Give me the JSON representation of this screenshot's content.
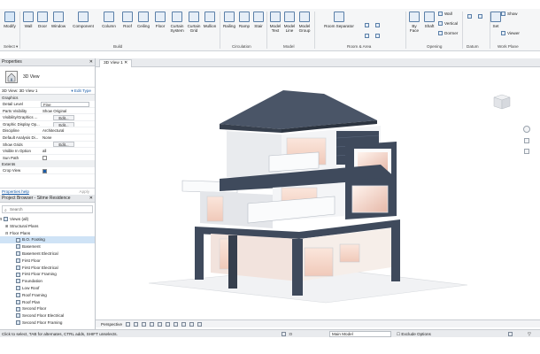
{
  "ribbon": {
    "buttons": [
      {
        "label": "Modify",
        "icon": "modify-arrow-icon"
      },
      {
        "label": "Wall",
        "icon": "wall-icon"
      },
      {
        "label": "Door",
        "icon": "door-icon"
      },
      {
        "label": "Window",
        "icon": "window-icon"
      },
      {
        "label": "Component",
        "icon": "component-icon"
      },
      {
        "label": "Column",
        "icon": "column-icon"
      },
      {
        "label": "Roof",
        "icon": "roof-icon"
      },
      {
        "label": "Ceiling",
        "icon": "ceiling-icon"
      },
      {
        "label": "Floor",
        "icon": "floor-icon"
      },
      {
        "label": "Curtain System",
        "icon": "curtain-system-icon"
      },
      {
        "label": "Curtain Grid",
        "icon": "curtain-grid-icon"
      },
      {
        "label": "Mullion",
        "icon": "mullion-icon"
      },
      {
        "label": "Railing",
        "icon": "railing-icon"
      },
      {
        "label": "Ramp",
        "icon": "ramp-icon"
      },
      {
        "label": "Stair",
        "icon": "stair-icon"
      },
      {
        "label": "Model Text",
        "icon": "model-text-icon"
      },
      {
        "label": "Model Line",
        "icon": "model-line-icon"
      },
      {
        "label": "Model Group",
        "icon": "model-group-icon"
      },
      {
        "label": "Room Separator",
        "icon": "room-separator-icon"
      },
      {
        "label": "By Face",
        "icon": "by-face-icon"
      },
      {
        "label": "Shaft",
        "icon": "shaft-icon"
      },
      {
        "label": "Set",
        "icon": "set-icon"
      }
    ],
    "small": {
      "wall": "Wall",
      "vertical": "Vertical",
      "dormer": "Dormer",
      "show": "Show",
      "viewer": "Viewer"
    },
    "groups": {
      "select": "Select",
      "build": "Build",
      "circulation": "Circulation",
      "model": "Model",
      "room_area": "Room & Area",
      "opening": "Opening",
      "datum": "Datum",
      "work_plane": "Work Plane"
    }
  },
  "properties": {
    "title": "Properties",
    "type_name": "3D View",
    "instance_label": "3D View: 3D View 1",
    "edit_type": "Edit Type",
    "category_graphics": "Graphics",
    "category_extents": "Extents",
    "rows": [
      {
        "k": "Detail Level",
        "v": "Fine",
        "kind": "box"
      },
      {
        "k": "Parts Visibility",
        "v": "Show Original",
        "kind": "text"
      },
      {
        "k": "Visibility/Graphics ...",
        "v": "Edit...",
        "kind": "btn"
      },
      {
        "k": "Graphic Display Op...",
        "v": "Edit...",
        "kind": "btn"
      },
      {
        "k": "Discipline",
        "v": "Architectural",
        "kind": "text"
      },
      {
        "k": "Default Analysis Di...",
        "v": "None",
        "kind": "text"
      },
      {
        "k": "Show Grids",
        "v": "Edit...",
        "kind": "btn"
      },
      {
        "k": "Visible In Option",
        "v": "all",
        "kind": "text"
      },
      {
        "k": "Sun Path",
        "v": "",
        "kind": "check"
      }
    ],
    "crop_view": "Crop View",
    "help": "Properties help",
    "apply": "Apply"
  },
  "browser": {
    "title": "Project Browser - Sitme Residence",
    "search_placeholder": "Search",
    "items": [
      {
        "label": "Views (all)",
        "indent": 0,
        "tog": "⊟",
        "icon": true,
        "hl": false
      },
      {
        "label": "Structural Plans",
        "indent": 1,
        "tog": "⊞",
        "icon": false,
        "hl": false
      },
      {
        "label": "Floor Plans",
        "indent": 1,
        "tog": "⊟",
        "icon": false,
        "hl": false
      },
      {
        "label": "B.O. Footing",
        "indent": 2,
        "tog": "",
        "icon": true,
        "hl": true
      },
      {
        "label": "Basement",
        "indent": 2,
        "tog": "",
        "icon": true,
        "hl": false
      },
      {
        "label": "Basement Electrical",
        "indent": 2,
        "tog": "",
        "icon": true,
        "hl": false
      },
      {
        "label": "First Floor",
        "indent": 2,
        "tog": "",
        "icon": true,
        "hl": false
      },
      {
        "label": "First Floor Electrical",
        "indent": 2,
        "tog": "",
        "icon": true,
        "hl": false
      },
      {
        "label": "First Floor Framing",
        "indent": 2,
        "tog": "",
        "icon": true,
        "hl": false
      },
      {
        "label": "Foundation",
        "indent": 2,
        "tog": "",
        "icon": true,
        "hl": false
      },
      {
        "label": "Low Roof",
        "indent": 2,
        "tog": "",
        "icon": true,
        "hl": false
      },
      {
        "label": "Roof Framing",
        "indent": 2,
        "tog": "",
        "icon": true,
        "hl": false
      },
      {
        "label": "Roof Plan",
        "indent": 2,
        "tog": "",
        "icon": true,
        "hl": false
      },
      {
        "label": "Second Floor",
        "indent": 2,
        "tog": "",
        "icon": true,
        "hl": false
      },
      {
        "label": "Second Floor Electrical",
        "indent": 2,
        "tog": "",
        "icon": true,
        "hl": false
      },
      {
        "label": "Second Floor Framing",
        "indent": 2,
        "tog": "",
        "icon": true,
        "hl": false
      }
    ]
  },
  "viewport": {
    "tab": "3D View 1",
    "scale": "Perspective"
  },
  "status": {
    "hint": "Click to select, TAB for alternates, CTRL adds, SHIFT unselects.",
    "zero": ":0",
    "model": "Main Model",
    "exclude": "Exclude Options"
  },
  "colors": {
    "accent": "#1a5ca8",
    "highlight": "#cfe3f6",
    "facade": "#3f4a5c",
    "wall": "#eef0f3"
  }
}
